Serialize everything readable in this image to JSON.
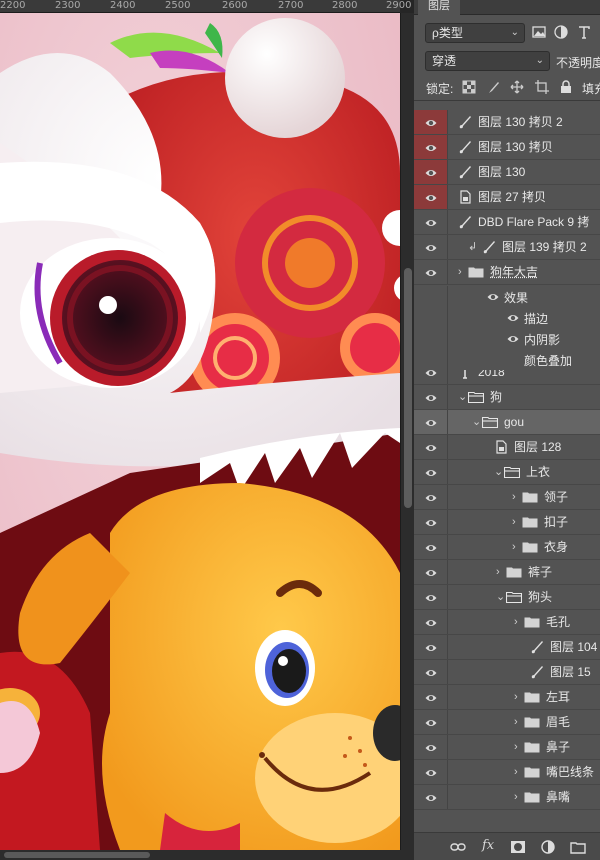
{
  "ruler": {
    "labels": [
      "2200",
      "2300",
      "2400",
      "2500",
      "2600",
      "2700",
      "2800",
      "2900"
    ]
  },
  "panel": {
    "tab_label": "图层",
    "filter": {
      "label": "ρ类型",
      "icons": [
        "image-filter-icon",
        "adjustment-filter-icon",
        "type-filter-icon"
      ]
    },
    "blend_mode": "穿透",
    "opacity_label": "不透明度",
    "lock_label": "锁定:",
    "fill_label": "填充"
  },
  "layers": [
    {
      "name": "图层 130 拷贝 2",
      "kind": "brush",
      "highlight": true
    },
    {
      "name": "图层 130 拷贝",
      "kind": "brush",
      "highlight": true
    },
    {
      "name": "图层 130",
      "kind": "brush",
      "highlight": true
    },
    {
      "name": "图层 27 拷贝",
      "kind": "smart",
      "highlight": true
    },
    {
      "name": "DBD Flare Pack 9 拷",
      "kind": "brush",
      "highlight": false
    },
    {
      "name": "图层 139 拷贝 2",
      "kind": "brush-clip",
      "highlight": false
    },
    {
      "name": "狗年大吉",
      "kind": "folder-closed",
      "highlight": false
    },
    {
      "name": "2018",
      "kind": "text",
      "highlight": false
    },
    {
      "name": "狗",
      "kind": "folder-open",
      "highlight": false
    },
    {
      "name": "gou",
      "kind": "folder-open",
      "highlight": false,
      "selected": true
    },
    {
      "name": "图层 128",
      "kind": "smart",
      "highlight": false
    },
    {
      "name": "上衣",
      "kind": "folder-open",
      "highlight": false
    },
    {
      "name": "领子",
      "kind": "folder-closed",
      "highlight": false
    },
    {
      "name": "扣子",
      "kind": "folder-closed",
      "highlight": false
    },
    {
      "name": "衣身",
      "kind": "folder-closed",
      "highlight": false
    },
    {
      "name": "裤子",
      "kind": "folder-closed",
      "highlight": false
    },
    {
      "name": "狗头",
      "kind": "folder-open",
      "highlight": false
    },
    {
      "name": "毛孔",
      "kind": "folder-closed",
      "highlight": false
    },
    {
      "name": "图层 104",
      "kind": "brush",
      "highlight": false
    },
    {
      "name": "图层 15",
      "kind": "brush",
      "highlight": false
    },
    {
      "name": "左耳",
      "kind": "folder-closed",
      "highlight": false
    },
    {
      "name": "眉毛",
      "kind": "folder-closed",
      "highlight": false
    },
    {
      "name": "鼻子",
      "kind": "folder-closed",
      "highlight": false
    },
    {
      "name": "嘴巴线条",
      "kind": "folder-closed",
      "highlight": false
    },
    {
      "name": "鼻嘴",
      "kind": "folder-closed",
      "highlight": false
    }
  ],
  "effects": {
    "header": "效果",
    "items": [
      "描边",
      "内阴影",
      "颜色叠加"
    ]
  },
  "footer": {
    "icons": [
      "link-icon",
      "fx-icon",
      "mask-icon",
      "adjustment-icon",
      "new-group-icon"
    ],
    "fx_label": "fx"
  },
  "colors": {
    "panel_bg": "#535353",
    "eye_highlight": "#8c3a3a",
    "selected_row": "#656565"
  }
}
